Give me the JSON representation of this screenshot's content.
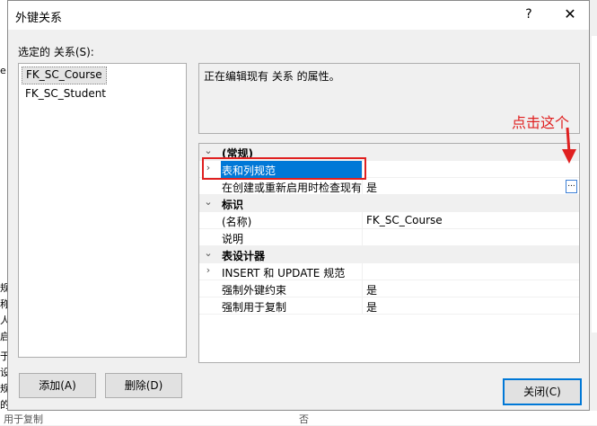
{
  "background": {
    "left_fragments": [
      "e",
      "规",
      "称",
      "人",
      "启",
      "于",
      "设",
      "规",
      "的"
    ],
    "bottom_left": "用于复制",
    "bottom_mid": "否"
  },
  "dialog": {
    "title": "外键关系",
    "help_glyph": "?",
    "close_glyph": "✕",
    "selected_relations_label": "选定的 关系(S):",
    "relations": [
      "FK_SC_Course",
      "FK_SC_Student"
    ],
    "selected_relation_index": 0,
    "description": "正在编辑现有 关系 的属性。",
    "buttons": {
      "add": "添加(A)",
      "delete": "删除(D)",
      "close": "关闭(C)"
    }
  },
  "grid": {
    "categories": {
      "general": "(常规)",
      "identity": "标识",
      "designer": "表设计器"
    },
    "rows": {
      "tables_columns": {
        "name": "表和列规范",
        "value": ""
      },
      "check_existing": {
        "name": "在创建或重新启用时检查现有",
        "value": "是"
      },
      "name": {
        "name": "(名称)",
        "value": "FK_SC_Course"
      },
      "description": {
        "name": "说明",
        "value": ""
      },
      "insert_update": {
        "name": "INSERT 和 UPDATE 规范",
        "value": ""
      },
      "enforce_fk": {
        "name": "强制外键约束",
        "value": "是"
      },
      "enforce_replication": {
        "name": "强制用于复制",
        "value": "是"
      }
    },
    "ellipsis_label": "..."
  },
  "annotation": {
    "text": "点击这个",
    "color": "#e02020"
  },
  "colors": {
    "selection": "#0078d7",
    "dialog_bg": "#f0f0f0"
  },
  "icons": {
    "expanded": "expand-down-icon",
    "collapsed": "expand-right-icon"
  }
}
